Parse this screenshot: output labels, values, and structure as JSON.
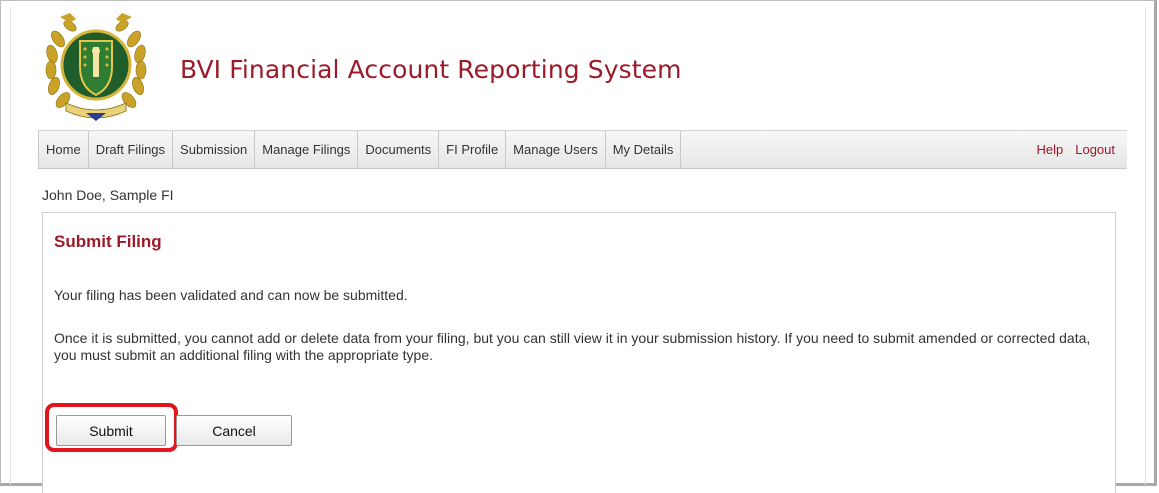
{
  "app": {
    "title": "BVI Financial Account Reporting System",
    "logo_icon": "bvi-coat-of-arms-seal-icon",
    "brand_color": "#9b1b2a"
  },
  "nav": {
    "items": [
      {
        "label": "Home"
      },
      {
        "label": "Draft Filings"
      },
      {
        "label": "Submission"
      },
      {
        "label": "Manage Filings"
      },
      {
        "label": "Documents"
      },
      {
        "label": "FI Profile"
      },
      {
        "label": "Manage Users"
      },
      {
        "label": "My Details"
      }
    ],
    "help_label": "Help",
    "logout_label": "Logout"
  },
  "user": {
    "display": "John Doe, Sample FI"
  },
  "panel": {
    "title": "Submit Filing",
    "message_validated": "Your filing has been validated and can now be submitted.",
    "message_info": "Once it is submitted, you cannot add or delete data from your filing, but you can still view it in your submission history. If you need to submit amended or corrected data, you must submit an additional filing with the appropriate type.",
    "submit_label": "Submit",
    "cancel_label": "Cancel",
    "highlight_color": "#e2141e"
  }
}
